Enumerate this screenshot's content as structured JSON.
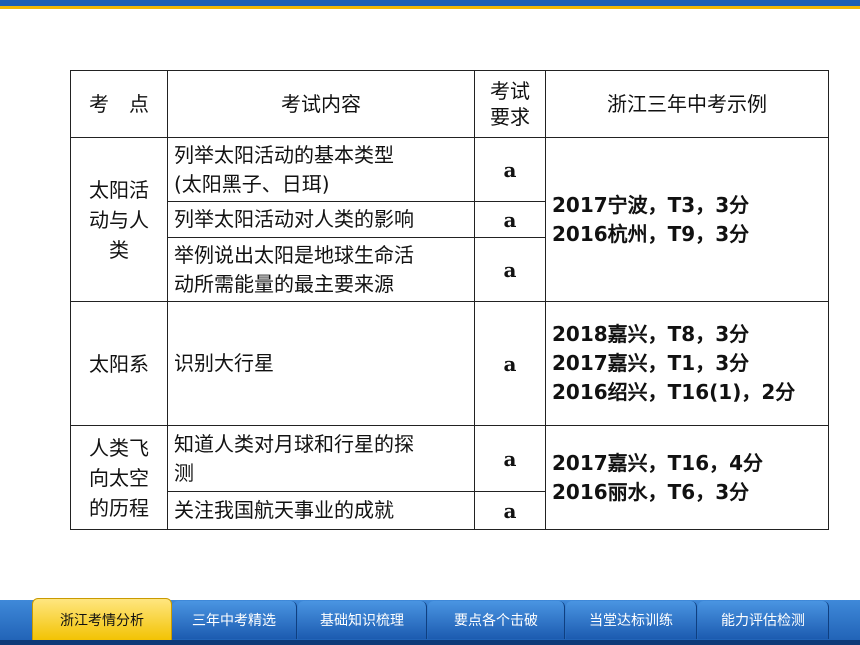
{
  "header": {
    "col1": "考　点",
    "col2": "考试内容",
    "col3_line1": "考试",
    "col3_line2": "要求",
    "col4": "浙江三年中考示例"
  },
  "groups": [
    {
      "topic_lines": [
        "太阳活",
        "动与人",
        "类"
      ],
      "rows": [
        {
          "content_lines": [
            "列举太阳活动的基本类型",
            "(太阳黑子、日珥)"
          ],
          "req": "a"
        },
        {
          "content_lines": [
            "列举太阳活动对人类的影响"
          ],
          "req": "a"
        },
        {
          "content_lines": [
            "举例说出太阳是地球生命活",
            "动所需能量的最主要来源"
          ],
          "req": "a"
        }
      ],
      "examples": [
        "2017宁波，T3，3分",
        "2016杭州，T9，3分"
      ]
    },
    {
      "topic_lines": [
        "太阳系"
      ],
      "rows": [
        {
          "content_lines": [
            "识别大行星"
          ],
          "req": "a"
        }
      ],
      "examples": [
        "2018嘉兴，T8，3分",
        "2017嘉兴，T1，3分",
        "2016绍兴，T16(1)，2分"
      ]
    },
    {
      "topic_lines": [
        "人类飞",
        "向太空",
        "的历程"
      ],
      "rows": [
        {
          "content_lines": [
            "知道人类对月球和行星的探",
            "测"
          ],
          "req": "a"
        },
        {
          "content_lines": [
            "关注我国航天事业的成就"
          ],
          "req": "a"
        }
      ],
      "examples": [
        "2017嘉兴，T16，4分",
        "2016丽水，T6，3分"
      ]
    }
  ],
  "tabs": [
    {
      "label": "浙江考情分析",
      "active": true
    },
    {
      "label": "三年中考精选",
      "active": false
    },
    {
      "label": "基础知识梳理",
      "active": false
    },
    {
      "label": "要点各个击破",
      "active": false
    },
    {
      "label": "当堂达标训练",
      "active": false
    },
    {
      "label": "能力评估检测",
      "active": false
    }
  ]
}
